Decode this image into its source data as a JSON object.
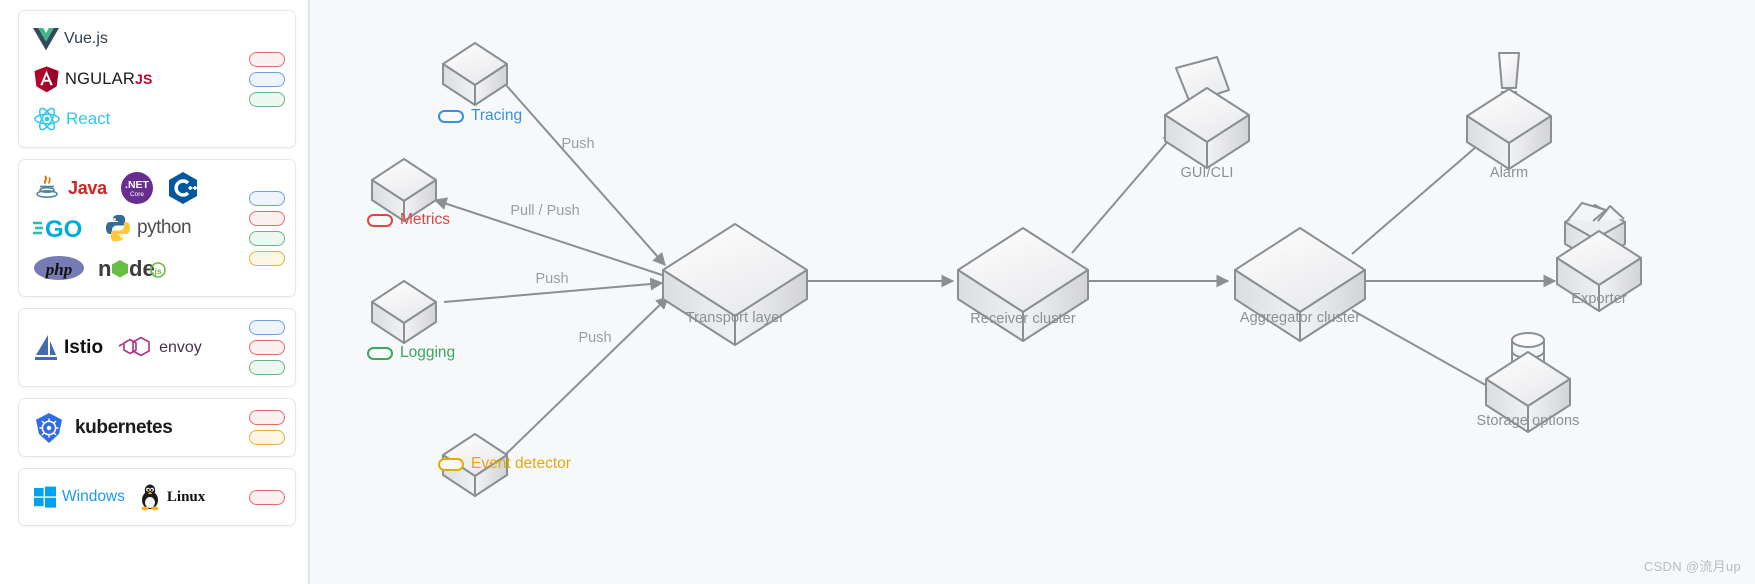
{
  "sidebar": {
    "groups": [
      {
        "name": "frontend-frameworks",
        "rows": [
          {
            "items": [
              {
                "icon": "vuejs-logo",
                "label": "Vue.js"
              }
            ]
          },
          {
            "items": [
              {
                "icon": "angularjs-logo",
                "label": "ANGULARJS"
              }
            ]
          },
          {
            "items": [
              {
                "icon": "react-logo",
                "label": "React"
              }
            ]
          }
        ],
        "pills": [
          "red",
          "blue",
          "green"
        ]
      },
      {
        "name": "backend-languages",
        "rows": [
          {
            "items": [
              {
                "icon": "java-logo",
                "label": "Java"
              },
              {
                "icon": "dotnet-core-logo",
                "label": ".NET Core"
              },
              {
                "icon": "cplusplus-logo",
                "label": "C++"
              }
            ]
          },
          {
            "items": [
              {
                "icon": "golang-logo",
                "label": "GO"
              },
              {
                "icon": "python-logo",
                "label": "python"
              }
            ]
          },
          {
            "items": [
              {
                "icon": "php-logo",
                "label": "php"
              },
              {
                "icon": "nodejs-logo",
                "label": "node js"
              }
            ]
          }
        ],
        "pills": [
          "blue",
          "red",
          "green",
          "yellow"
        ]
      },
      {
        "name": "service-mesh",
        "rows": [
          {
            "items": [
              {
                "icon": "istio-logo",
                "label": "Istio"
              },
              {
                "icon": "envoy-logo",
                "label": "envoy"
              }
            ]
          }
        ],
        "pills": [
          "blue",
          "red",
          "green"
        ]
      },
      {
        "name": "orchestration",
        "rows": [
          {
            "items": [
              {
                "icon": "kubernetes-logo",
                "label": "kubernetes"
              }
            ]
          }
        ],
        "pills": [
          "red",
          "yellow"
        ]
      },
      {
        "name": "operating-systems",
        "rows": [
          {
            "items": [
              {
                "icon": "windows-logo",
                "label": "Windows"
              },
              {
                "icon": "linux-tux-logo",
                "label": "Linux"
              }
            ]
          }
        ],
        "pills": [
          "red"
        ]
      }
    ]
  },
  "diagram": {
    "sources": [
      {
        "id": "tracing",
        "label": "Tracing",
        "color": "#3b8fe0",
        "edge_label": "Push"
      },
      {
        "id": "metrics",
        "label": "Metrics",
        "color": "#e0453f",
        "edge_label": "Pull / Push"
      },
      {
        "id": "logging",
        "label": "Logging",
        "color": "#3aa85f",
        "edge_label": "Push"
      },
      {
        "id": "event-detector",
        "label": "Event detector",
        "color": "#e8a80c",
        "edge_label": "Push"
      }
    ],
    "pipeline": [
      {
        "id": "transport-layer",
        "label": "Transport layer"
      },
      {
        "id": "receiver-cluster",
        "label": "Receiver cluster"
      },
      {
        "id": "aggregator-cluster",
        "label": "Aggregator cluster"
      }
    ],
    "outputs": [
      {
        "id": "gui-cli",
        "label": "GUI/CLI",
        "icon": "monitor-icon"
      },
      {
        "id": "alarm",
        "label": "Alarm",
        "icon": "siren-icon"
      },
      {
        "id": "exporter",
        "label": "Exporter",
        "icon": "open-box-icon"
      },
      {
        "id": "storage-options",
        "label": "Storage options",
        "icon": "database-icon"
      }
    ]
  },
  "watermark": {
    "text": "CSDN @流月up"
  }
}
